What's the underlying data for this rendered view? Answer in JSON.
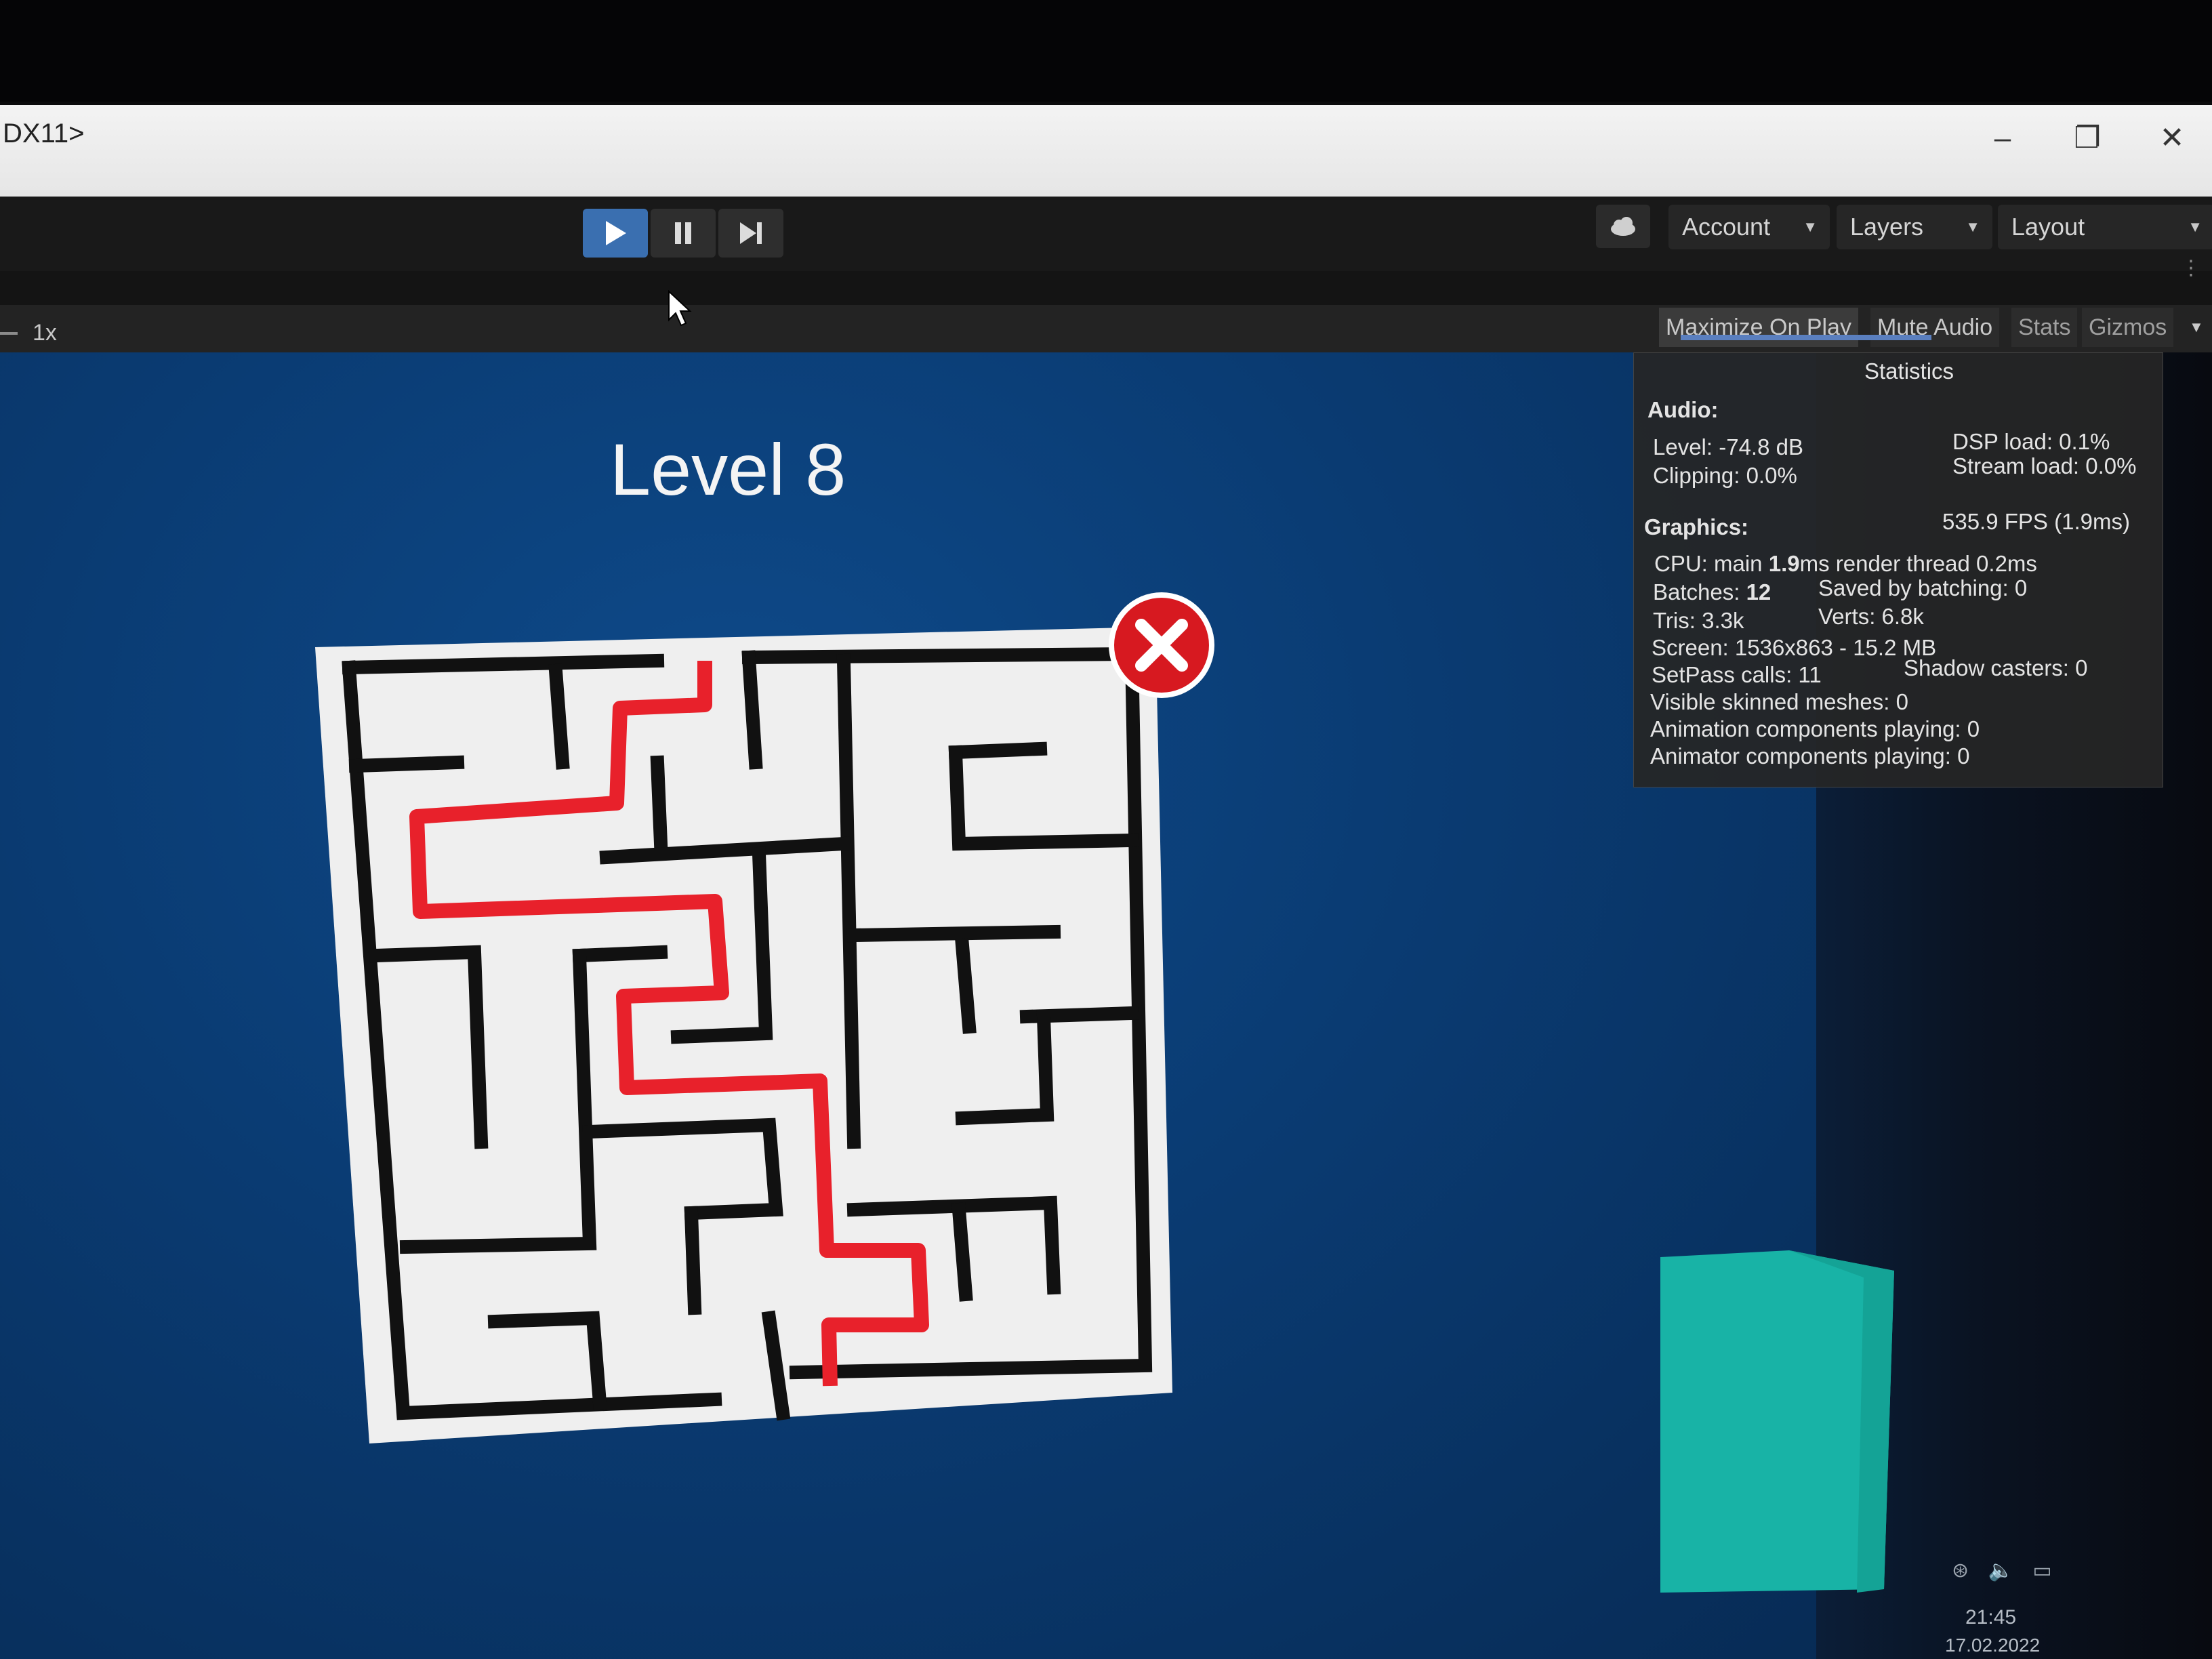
{
  "window": {
    "title": "DX11>",
    "minimize": "–",
    "maximize": "❐",
    "close": "✕"
  },
  "toolbar": {
    "play_icon": "play-icon",
    "pause_icon": "pause-icon",
    "step_icon": "step-icon",
    "cloud_icon": "cloud-icon",
    "account_label": "Account",
    "layers_label": "Layers",
    "layout_label": "Layout",
    "dropdown_arrow": "▼"
  },
  "game_bar": {
    "scale": "1x",
    "maximize_on_play": "Maximize On Play",
    "mute_audio": "Mute Audio",
    "stats": "Stats",
    "gizmos": "Gizmos",
    "gizmos_arrow": "▼"
  },
  "game": {
    "level_title": "Level 8",
    "close_icon": "close-icon",
    "colors": {
      "background": "#0a3b72",
      "path": "#e8212b",
      "walls": "#111111",
      "cube": "#17b6a8"
    }
  },
  "stats": {
    "title": "Statistics",
    "audio_header": "Audio:",
    "level": "Level: -74.8 dB",
    "clipping": "Clipping: 0.0%",
    "dsp_load": "DSP load: 0.1%",
    "stream_load": "Stream load: 0.0%",
    "graphics_header": "Graphics:",
    "fps": "535.9 FPS (1.9ms)",
    "cpu_prefix": "CPU: main ",
    "cpu_main": "1.9",
    "cpu_suffix": "ms  render thread 0.2ms",
    "batches_prefix": "Batches: ",
    "batches": "12",
    "saved_batching": "Saved by batching: 0",
    "tris": "Tris: 3.3k",
    "verts": "Verts: 6.8k",
    "screen": "Screen: 1536x863 - 15.2 MB",
    "setpass": "SetPass calls: 11",
    "shadow_casters": "Shadow casters: 0",
    "skinned": "Visible skinned meshes: 0",
    "animation": "Animation components playing: 0",
    "animator": "Animator components playing: 0"
  },
  "taskbar": {
    "time": "21:45",
    "date": "17.02.2022"
  }
}
